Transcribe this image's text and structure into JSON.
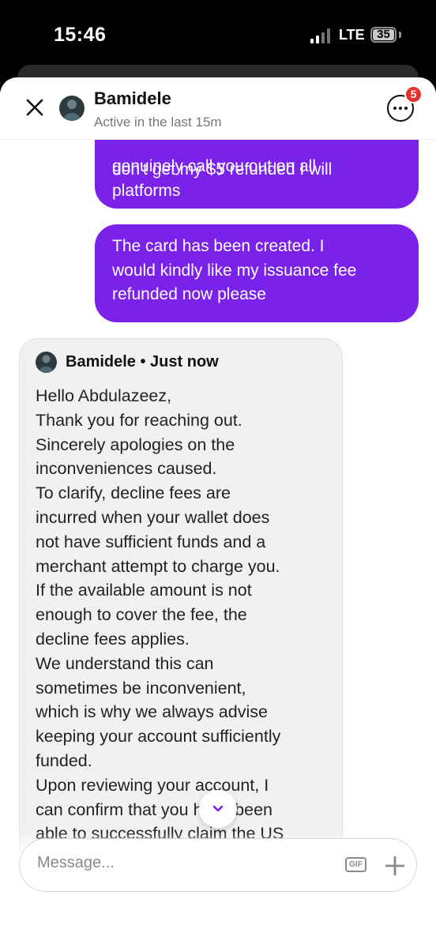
{
  "status_bar": {
    "time": "15:46",
    "network": "LTE",
    "battery": "35"
  },
  "header": {
    "name": "Bamidele",
    "status": "Active in the last 15m",
    "badge_count": "5"
  },
  "messages": {
    "outgoing_1": {
      "clipped_line": "don't get my $5 refunded I will",
      "lines": [
        "genuinely call you out on all",
        "platforms"
      ]
    },
    "outgoing_2": {
      "lines": [
        "The card has been created. I",
        "would kindly like my issuance fee",
        "refunded now please"
      ]
    },
    "incoming_1": {
      "sender": "Bamidele • Just now",
      "lines": [
        "Hello Abdulazeez,",
        "Thank you for reaching out.",
        "Sincerely apologies on the",
        "inconveniences caused.",
        "To clarify, decline fees are",
        "incurred when your wallet does",
        "not have sufficient funds and a",
        "merchant attempt to charge you.",
        "If the available amount is not",
        "enough to cover the fee, the",
        "decline fees applies.",
        "We understand this can",
        "sometimes be inconvenient,",
        "which is why we always advise",
        "keeping your account sufficiently",
        "funded.",
        "Upon reviewing your account, I",
        "can confirm that you have been",
        "able to successfully claim the US"
      ]
    }
  },
  "composer": {
    "placeholder": "Message...",
    "gif_label": "GIF"
  },
  "colors": {
    "outgoing_bubble": "#7b22ea",
    "incoming_bubble": "#f1f1f2",
    "badge": "#e5312b"
  }
}
